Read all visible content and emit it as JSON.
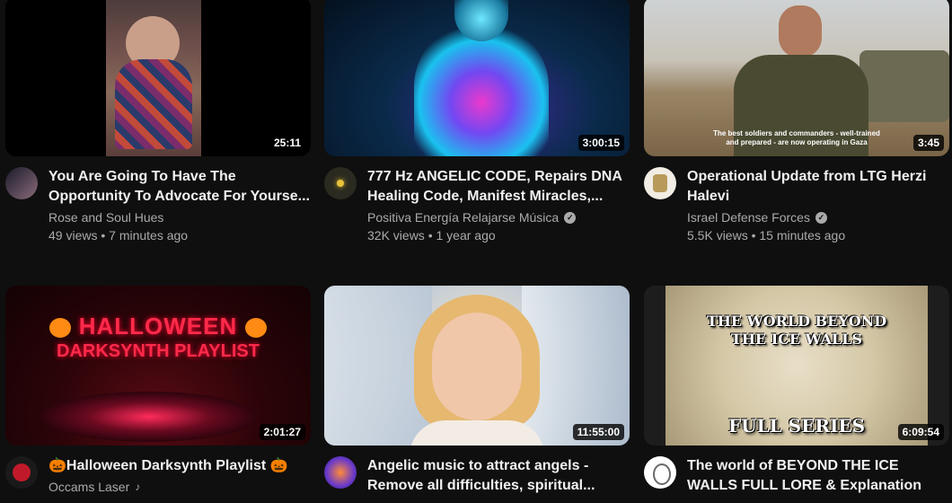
{
  "videos": [
    {
      "duration": "25:11",
      "title": "You Are Going To Have The Opportunity To Advocate For Yourse...",
      "channel": "Rose and Soul Hues",
      "stats": "49 views • 7 minutes ago"
    },
    {
      "duration": "3:00:15",
      "title": "777 Hz ANGELIC CODE, Repairs DNA Healing Code, Manifest Miracles,...",
      "channel": "Positiva Energía Relajarse Música",
      "stats": "32K views • 1 year ago"
    },
    {
      "duration": "3:45",
      "title": "Operational Update from LTG Herzi Halevi",
      "channel": "Israel Defense Forces",
      "stats": "5.5K views • 15 minutes ago",
      "thumb_caption": "The best soldiers and commanders - well-trained and prepared - are now operating in Gaza"
    },
    {
      "duration": "2:01:27",
      "title": "🎃Halloween Darksynth Playlist 🎃",
      "channel": "Occams Laser",
      "thumb_line1": "HALLOWEEN",
      "thumb_line2": "DARKSYNTH PLAYLIST"
    },
    {
      "duration": "11:55:00",
      "title": "Angelic music to attract angels - Remove all difficulties, spiritual..."
    },
    {
      "duration": "6:09:54",
      "title": "The world of BEYOND THE ICE WALLS FULL LORE & Explanation",
      "thumb_line1": "THE WORLD BEYOND",
      "thumb_line2": "THE ICE WALLS",
      "thumb_line3": "FULL SERIES"
    }
  ]
}
